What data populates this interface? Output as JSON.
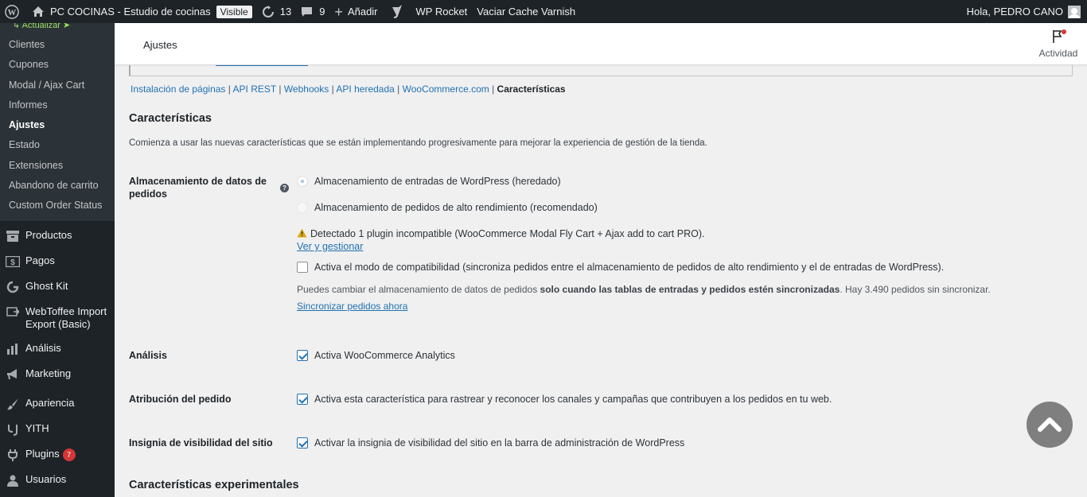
{
  "adminbar": {
    "site_name": "PC COCINAS - Estudio de cocinas",
    "visibility_badge": "Visible",
    "updates_count": "13",
    "comments_count": "9",
    "new_label": "Añadir",
    "wp_rocket": "WP Rocket",
    "varnish": "Vaciar Cache Varnish",
    "greeting": "Hola, PEDRO CANO"
  },
  "sidebar": {
    "update_label": "Actualizar",
    "submenu": [
      "Clientes",
      "Cupones",
      "Modal / Ajax Cart",
      "Informes",
      "Ajustes",
      "Estado",
      "Extensiones",
      "Abandono de carrito",
      "Custom Order Status"
    ],
    "menu": [
      {
        "label": "Productos",
        "icon": "archive-icon"
      },
      {
        "label": "Pagos",
        "icon": "money-icon"
      },
      {
        "label": "Ghost Kit",
        "icon": "ghostkit-icon"
      },
      {
        "label": "WebToffee Import Export (Basic)",
        "icon": "import-export-icon"
      },
      {
        "label": "Análisis",
        "icon": "chart-bar-icon"
      },
      {
        "label": "Marketing",
        "icon": "megaphone-icon"
      },
      {
        "label": "Apariencia",
        "icon": "brush-icon"
      },
      {
        "label": "YITH",
        "icon": "yith-icon"
      },
      {
        "label": "Plugins",
        "icon": "plugin-icon",
        "count": "7"
      },
      {
        "label": "Usuarios",
        "icon": "users-icon"
      }
    ]
  },
  "header": {
    "title": "Ajustes",
    "activity_label": "Actividad"
  },
  "subsubsub": [
    "Instalación de páginas",
    "API REST",
    "Webhooks",
    "API heredada",
    "WooCommerce.com",
    "Características"
  ],
  "page": {
    "heading": "Características",
    "description": "Comienza a usar las nuevas características que se están implementando progresivamente para mejorar la experiencia de gestión de la tienda.",
    "storage_label": "Almacenamiento de datos de pedidos",
    "storage_options": [
      "Almacenamiento de entradas de WordPress (heredado)",
      "Almacenamiento de pedidos de alto rendimiento (recomendado)"
    ],
    "warning": "Detectado 1 plugin incompatible (WooCommerce Modal Fly Cart + Ajax add to cart PRO).",
    "manage_link": "Ver y gestionar",
    "compat_mode": "Activa el modo de compatibilidad (sincroniza pedidos entre el almacenamiento de pedidos de alto rendimiento y el de entradas de WordPress).",
    "note_prefix": "Puedes cambiar el almacenamiento de datos de pedidos ",
    "note_bold": "solo cuando las tablas de entradas y pedidos estén sincronizadas",
    "note_suffix": ". Hay 3.490 pedidos sin sincronizar.",
    "sync_link": "Sincronizar pedidos ahora",
    "analytics_label": "Análisis",
    "analytics_option": "Activa WooCommerce Analytics",
    "attribution_label": "Atribución del pedido",
    "attribution_option": "Activa esta característica para rastrear y reconocer los canales y campañas que contribuyen a los pedidos en tu web.",
    "badge_label": "Insignia de visibilidad del sitio",
    "badge_option": "Activar la insignia de visibilidad del sitio en la barra de administración de WordPress",
    "experimental_heading": "Características experimentales"
  },
  "colors": {
    "adminbar_bg": "#1d2327",
    "link": "#2271b1",
    "accent_green": "#9bde5d",
    "plugin_badge": "#d63638"
  }
}
